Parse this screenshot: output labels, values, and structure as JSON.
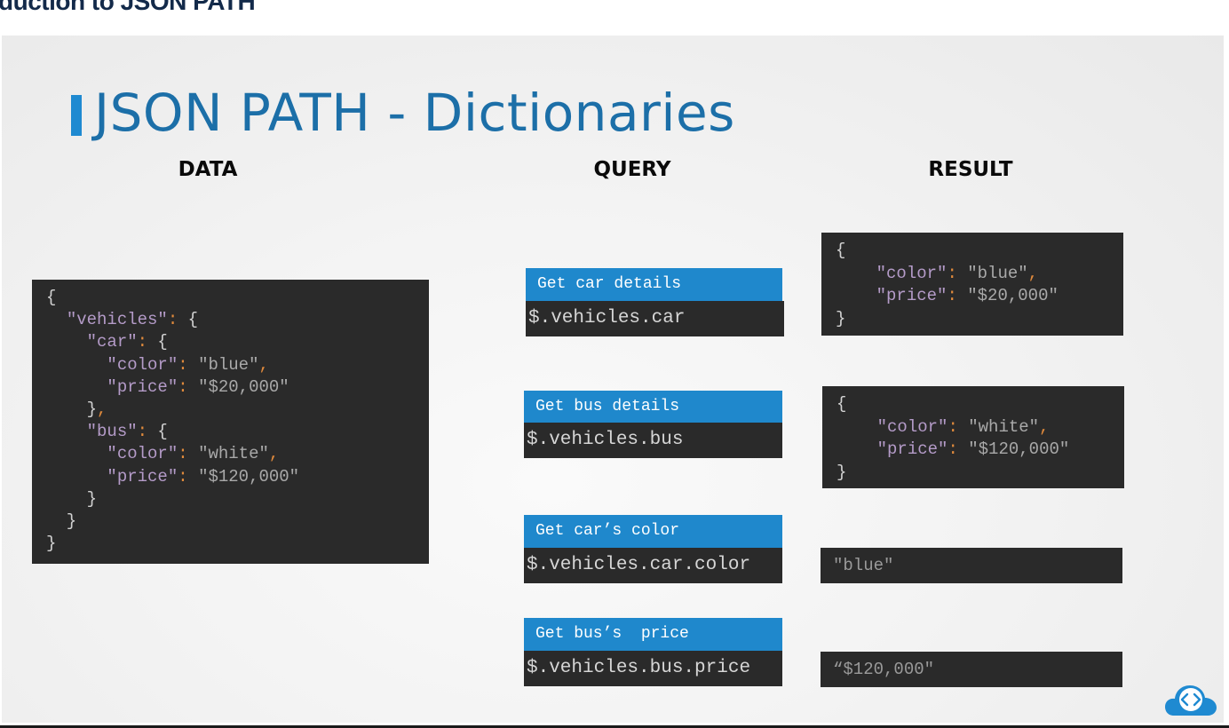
{
  "header": {
    "title": "duction to JSON PATH"
  },
  "slide": {
    "title": "JSON PATH - Dictionaries",
    "columns": {
      "data": "DATA",
      "query": "QUERY",
      "result": "RESULT"
    }
  },
  "data_code": {
    "l1": "{",
    "vehicles_key": "\"vehicles\"",
    "car_key": "\"car\"",
    "color_key": "\"color\"",
    "car_color": "\"blue\"",
    "price_key": "\"price\"",
    "car_price": "\"$20,000\"",
    "bus_key": "\"bus\"",
    "bus_color": "\"white\"",
    "bus_price": "\"$120,000\""
  },
  "queries": [
    {
      "label": "Get car details",
      "expr": "$.vehicles.car"
    },
    {
      "label": "Get bus details",
      "expr": "$.vehicles.bus"
    },
    {
      "label": "Get car’s color",
      "expr": "$.vehicles.car.color"
    },
    {
      "label": "Get bus’s  price",
      "expr": "$.vehicles.bus.price"
    }
  ],
  "results": [
    {
      "color_key": "\"color\"",
      "color": "\"blue\"",
      "price_key": "\"price\"",
      "price": "\"$20,000\""
    },
    {
      "color_key": "\"color\"",
      "color": "\"white\"",
      "price_key": "\"price\"",
      "price": "\"$120,000\""
    },
    {
      "value": "\"blue\""
    },
    {
      "value": "“$120,000\""
    }
  ],
  "colors": {
    "accent_blue": "#1f88cc",
    "title_blue": "#1c6fa8",
    "code_bg": "#2a2a2a",
    "key_purple": "#b49bc8",
    "punct_orange": "#e08a3c"
  },
  "icons": {
    "logo": "code-cloud-icon"
  }
}
